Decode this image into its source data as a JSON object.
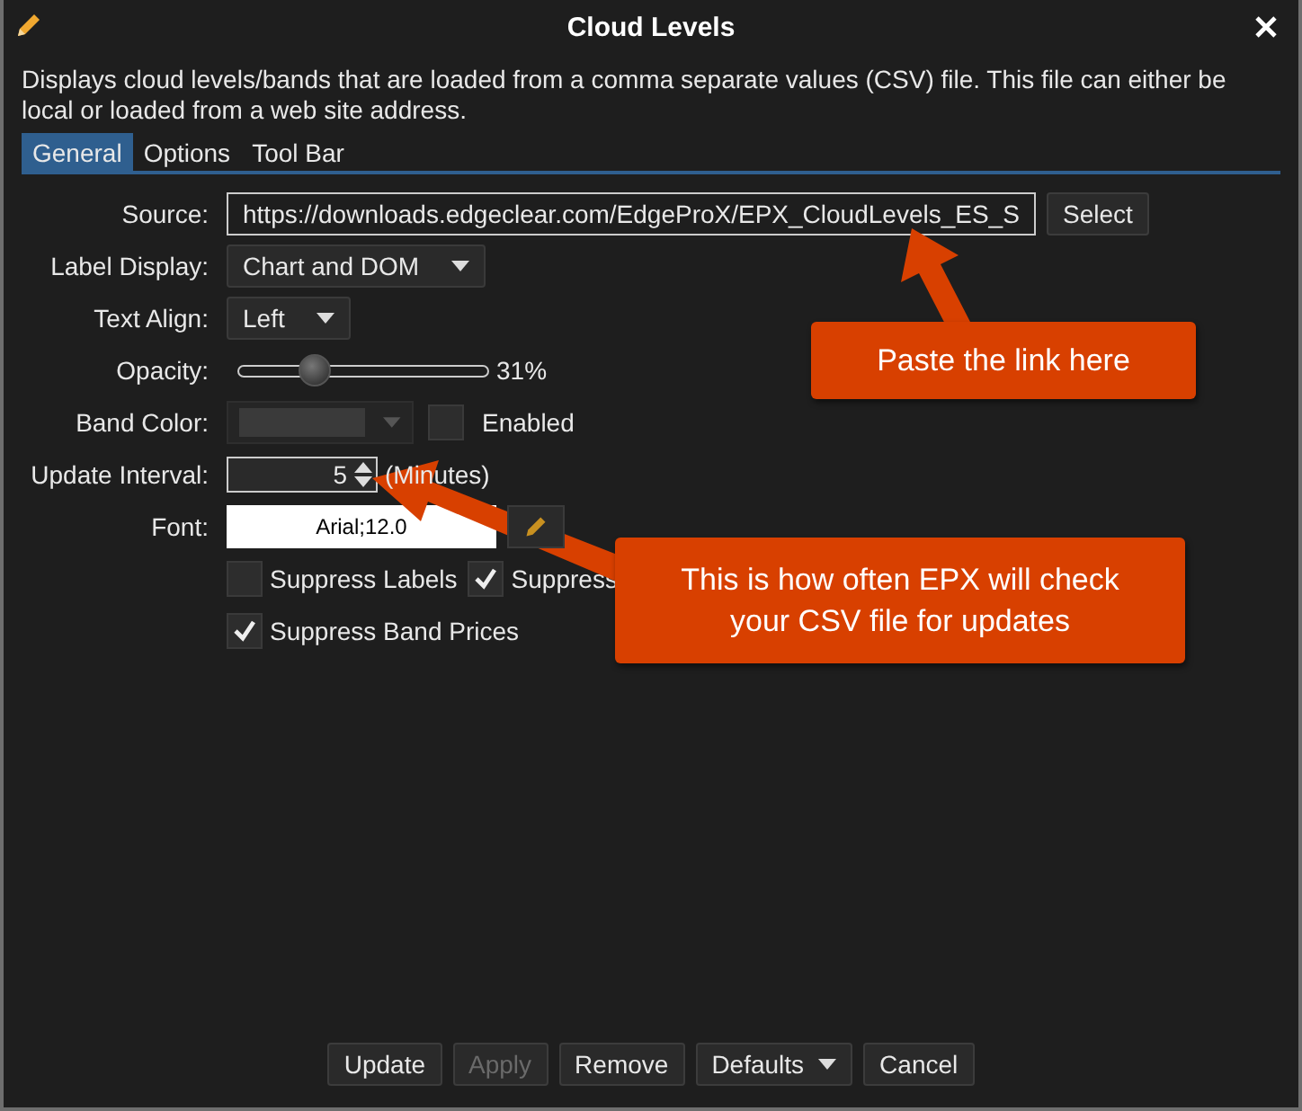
{
  "window": {
    "title": "Cloud Levels"
  },
  "description": "Displays cloud levels/bands that are loaded from a comma separate values (CSV) file.  This file can either be local or loaded from a web site address.",
  "tabs": [
    {
      "label": "General",
      "selected": true
    },
    {
      "label": "Options",
      "selected": false
    },
    {
      "label": "Tool Bar",
      "selected": false
    }
  ],
  "fields": [
    {
      "kind": "text",
      "label": "Source:",
      "value": "https://downloads.edgeclear.com/EdgeProX/EPX_CloudLevels_ES_S",
      "button": "Select"
    },
    {
      "kind": "dropdown",
      "label": "Label Display:",
      "value": "Chart and DOM"
    },
    {
      "kind": "dropdown",
      "label": "Text Align:",
      "value": "Left"
    },
    {
      "kind": "slider",
      "label": "Opacity:",
      "level": 0.31,
      "reading": "31%"
    },
    {
      "kind": "color",
      "label": "Band Color:",
      "disabled": true,
      "checkbox": {
        "label": "Enabled",
        "checked": false
      }
    },
    {
      "kind": "spinner",
      "label": "Update Interval:",
      "value": "5",
      "unit": "(Minutes)"
    },
    {
      "kind": "font",
      "label": "Font:",
      "value": "Arial;12.0"
    }
  ],
  "checkbox_rows": [
    [
      {
        "label": "Suppress Labels",
        "checked": false
      },
      {
        "label": "Suppress",
        "checked": true
      }
    ],
    [
      {
        "label": "Suppress Band Prices",
        "checked": true
      }
    ]
  ],
  "buttons": [
    {
      "label": "Update",
      "disabled": false,
      "dropdown": false
    },
    {
      "label": "Apply",
      "disabled": true,
      "dropdown": false
    },
    {
      "label": "Remove",
      "disabled": false,
      "dropdown": false
    },
    {
      "label": "Defaults",
      "disabled": false,
      "dropdown": true
    },
    {
      "label": "Cancel",
      "disabled": false,
      "dropdown": false
    }
  ],
  "callouts": [
    {
      "text": "Paste the link here"
    },
    {
      "text": "This is how often EPX will check your CSV file for updates"
    }
  ]
}
